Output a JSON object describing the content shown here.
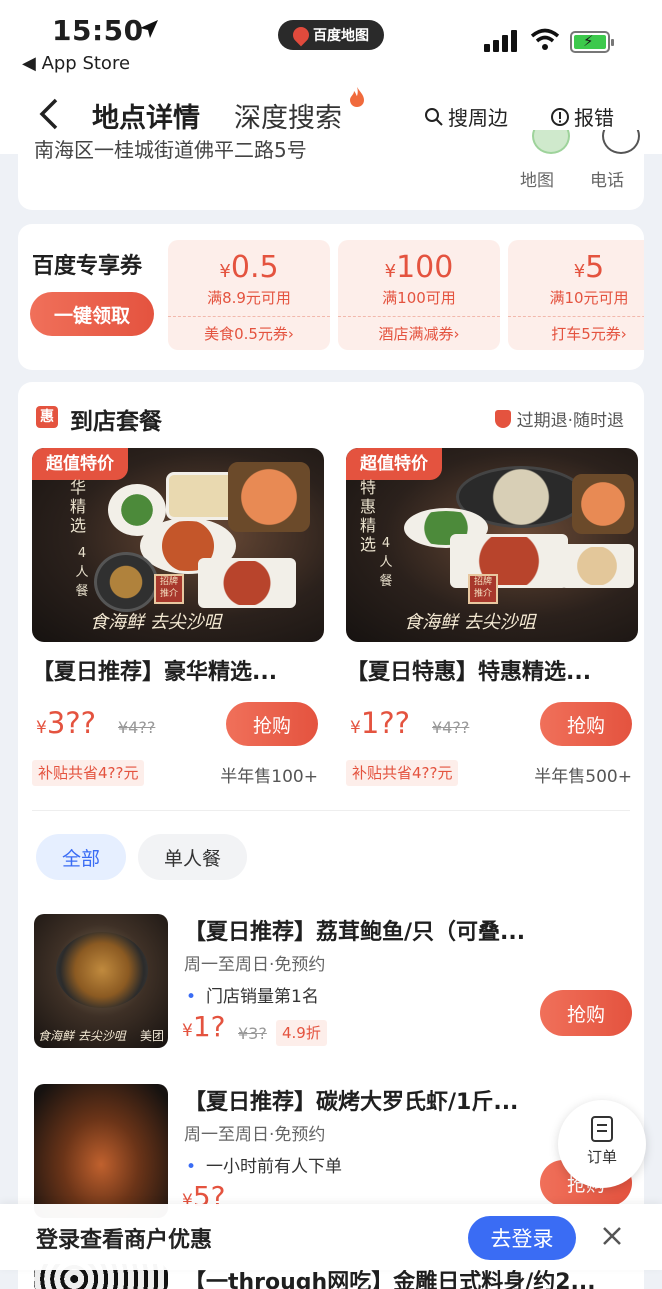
{
  "status_bar": {
    "time": "15:50",
    "back_app": "◀ App Store",
    "app_pill": "百度地图"
  },
  "nav": {
    "tab_detail": "地点详情",
    "tab_search": "深度搜索",
    "nearby": "搜周边",
    "report": "报错"
  },
  "place": {
    "address": "南海区一桂城街道佛平二路5号",
    "map_label": "地图",
    "phone_label": "电话"
  },
  "coupons": {
    "title": "百度专享券",
    "claim_button": "一键领取",
    "items": [
      {
        "currency": "¥",
        "amount": "0.5",
        "condition": "满8.9元可用",
        "label": "美食0.5元券›"
      },
      {
        "currency": "¥",
        "amount": "100",
        "condition": "满100可用",
        "label": "酒店满减券›"
      },
      {
        "currency": "¥",
        "amount": "5",
        "condition": "满10元可用",
        "label": "打车5元券›"
      }
    ]
  },
  "deals": {
    "badge_icon": "惠",
    "title": "到店套餐",
    "guarantee": "过期退·随时退",
    "packages": [
      {
        "badge": "超值特价",
        "vertical_text": "华精选",
        "vertical_sub": "4人餐",
        "seal": "招牌 推介",
        "slogan": "食海鲜 去尖沙咀",
        "name": "【夏日推荐】豪华精选...",
        "currency": "¥",
        "price": "3??",
        "original": "¥4??",
        "buy": "抢购",
        "saving": "补贴共省4??元",
        "sold": "半年售100+"
      },
      {
        "badge": "超值特价",
        "vertical_text": "特惠精选",
        "vertical_sub": "4人餐",
        "seal": "招牌 推介",
        "slogan": "食海鲜 去尖沙咀",
        "name": "【夏日特惠】特惠精选...",
        "currency": "¥",
        "price": "1??",
        "original": "¥4??",
        "buy": "抢购",
        "saving": "补贴共省4??元",
        "sold": "半年售500+"
      }
    ],
    "filters": [
      "全部",
      "单人餐"
    ],
    "items": [
      {
        "title": "【夏日推荐】荔茸鲍鱼/只（可叠...",
        "subtitle": "周一至周日·免预约",
        "highlight": "门店销量第1名",
        "currency": "¥",
        "price": "1?",
        "original": "¥3?",
        "discount": "4.9折",
        "buy": "抢购",
        "thumb_tag": "美团",
        "thumb_slogan": "食海鲜 去尖沙咀"
      },
      {
        "title": "【夏日推荐】碳烤大罗氏虾/1斤...",
        "subtitle": "周一至周日·免预约",
        "highlight": "一小时前有人下单",
        "currency": "¥",
        "price": "5?",
        "original": "",
        "discount": "",
        "buy": "抢购",
        "thumb_tag": "",
        "thumb_slogan": ""
      },
      {
        "title": "【一through网吃】金雕日式料身/约2..."
      }
    ]
  },
  "float": {
    "order_label": "订单"
  },
  "login_bar": {
    "text": "登录查看商户优惠",
    "button": "去登录"
  }
}
